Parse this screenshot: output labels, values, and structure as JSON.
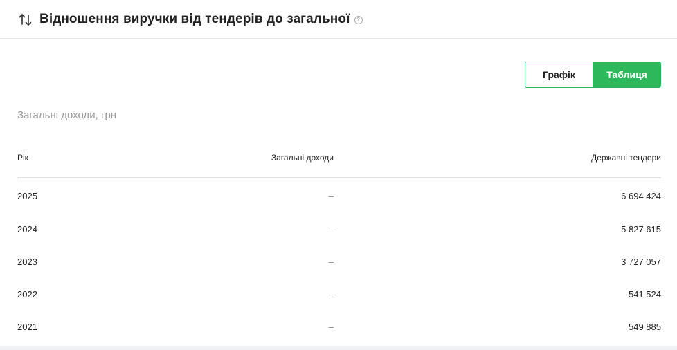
{
  "header": {
    "title": "Відношення виручки від тендерів до загальної",
    "help": "?"
  },
  "toggle": {
    "chart_label": "Графік",
    "table_label": "Таблиця",
    "active": "table"
  },
  "subtitle": "Загальні доходи, грн",
  "table": {
    "columns": [
      "Рік",
      "Загальні доходи",
      "Державні тендери"
    ],
    "rows": [
      {
        "year": "2025",
        "total": "–",
        "gov": "6 694 424"
      },
      {
        "year": "2024",
        "total": "–",
        "gov": "5 827 615"
      },
      {
        "year": "2023",
        "total": "–",
        "gov": "3 727 057"
      },
      {
        "year": "2022",
        "total": "–",
        "gov": "541 524"
      },
      {
        "year": "2021",
        "total": "–",
        "gov": "549 885"
      }
    ]
  },
  "colors": {
    "accent": "#2eb85c",
    "muted": "#9a9a9a"
  }
}
